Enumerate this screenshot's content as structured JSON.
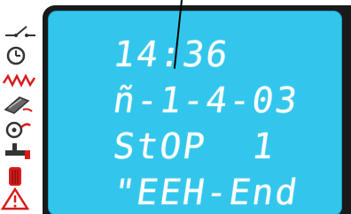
{
  "display": {
    "lines": [
      "14:36",
      "ñ-1-4-03",
      "StOP  1",
      "\"EEH-End"
    ]
  },
  "icons": [
    "switch-icon",
    "clock-icon",
    "heating-zigzag-icon",
    "flame-burner-icon",
    "pump-fan-icon",
    "tap-water-icon",
    "boiler-icon",
    "warning-triangle-icon"
  ],
  "colors": {
    "lcd_background": "#33c6ec",
    "lcd_text": "#ffffff",
    "bezel": "#1a1a1a",
    "icon_red": "#d81b1b",
    "icon_dark": "#333333"
  }
}
